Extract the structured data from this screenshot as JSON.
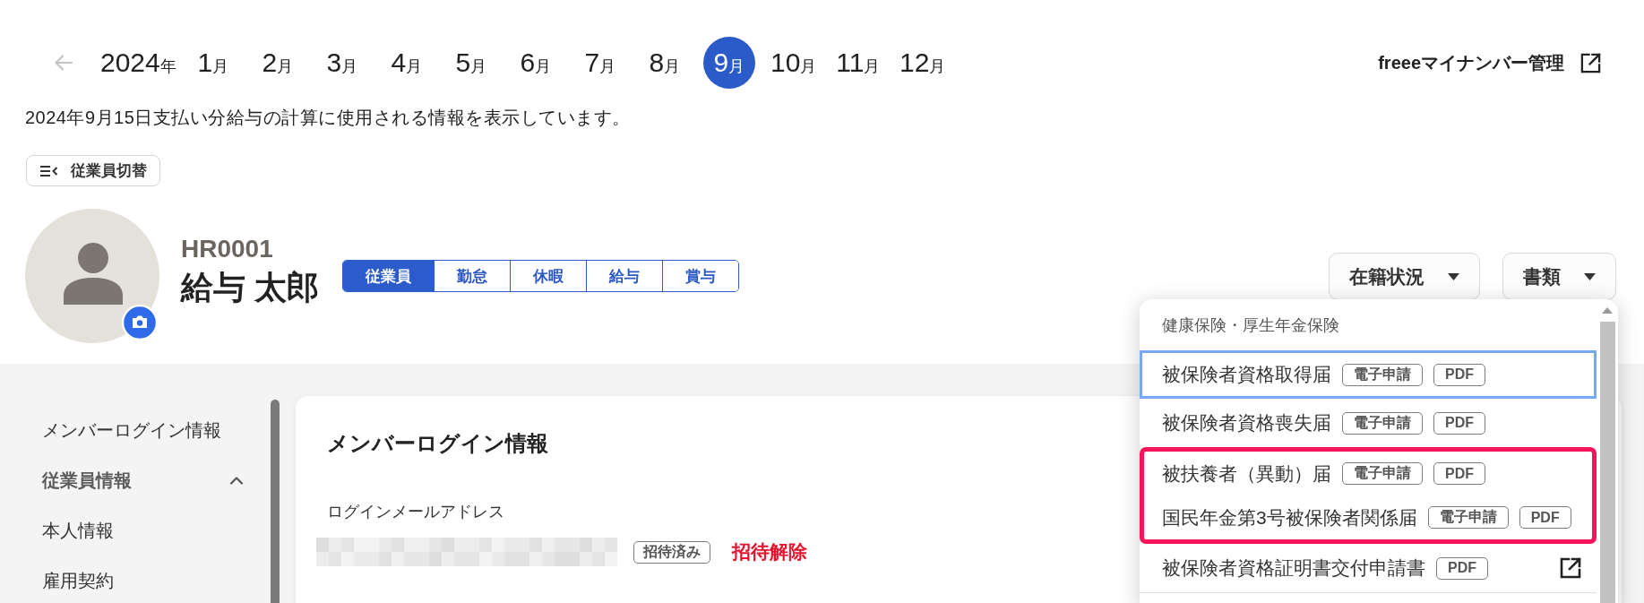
{
  "year_nav": {
    "previous_disabled": true,
    "year": "2024",
    "year_unit": "年",
    "months": [
      {
        "number": "1",
        "unit": "月",
        "selected": false
      },
      {
        "number": "2",
        "unit": "月",
        "selected": false
      },
      {
        "number": "3",
        "unit": "月",
        "selected": false
      },
      {
        "number": "4",
        "unit": "月",
        "selected": false
      },
      {
        "number": "5",
        "unit": "月",
        "selected": false
      },
      {
        "number": "6",
        "unit": "月",
        "selected": false
      },
      {
        "number": "7",
        "unit": "月",
        "selected": false
      },
      {
        "number": "8",
        "unit": "月",
        "selected": false
      },
      {
        "number": "9",
        "unit": "月",
        "selected": true
      },
      {
        "number": "10",
        "unit": "月",
        "selected": false
      },
      {
        "number": "11",
        "unit": "月",
        "selected": false
      },
      {
        "number": "12",
        "unit": "月",
        "selected": false
      }
    ]
  },
  "external_link": {
    "label": "freeeマイナンバー管理"
  },
  "notice": "2024年9月15日支払い分給与の計算に使用される情報を表示しています。",
  "switch_button": {
    "label": "従業員切替"
  },
  "employee": {
    "id": "HR0001",
    "name": "給与 太郎"
  },
  "tabs": [
    {
      "label": "従業員",
      "selected": true
    },
    {
      "label": "勤怠",
      "selected": false
    },
    {
      "label": "休暇",
      "selected": false
    },
    {
      "label": "給与",
      "selected": false
    },
    {
      "label": "賞与",
      "selected": false
    }
  ],
  "actions": [
    {
      "label": "在籍状況"
    },
    {
      "label": "書類"
    }
  ],
  "sidebar": {
    "items": [
      {
        "kind": "link",
        "label": "メンバーログイン情報"
      },
      {
        "kind": "group",
        "label": "従業員情報",
        "expanded": true,
        "children": [
          {
            "kind": "link",
            "label": "本人情報"
          },
          {
            "kind": "link",
            "label": "雇用契約"
          }
        ]
      }
    ]
  },
  "card": {
    "title": "メンバーログイン情報",
    "field_label": "ログインメールアドレス",
    "status": "招待済み",
    "action": "招待解除"
  },
  "documents_menu": {
    "section_title": "健康保険・厚生年金保険",
    "items": [
      {
        "name": "被保険者資格取得届",
        "focused": true,
        "highlighted": false,
        "external": false,
        "formats": [
          "電子申請",
          "PDF"
        ]
      },
      {
        "name": "被保険者資格喪失届",
        "focused": false,
        "highlighted": false,
        "external": false,
        "formats": [
          "電子申請",
          "PDF"
        ]
      },
      {
        "name": "被扶養者（異動）届",
        "focused": false,
        "highlighted": true,
        "external": false,
        "formats": [
          "電子申請",
          "PDF"
        ]
      },
      {
        "name": "国民年金第3号被保険者関係届",
        "focused": false,
        "highlighted": true,
        "external": false,
        "formats": [
          "電子申請",
          "PDF"
        ]
      },
      {
        "name": "被保険者資格証明書交付申請書",
        "focused": false,
        "highlighted": false,
        "external": true,
        "formats": [
          "PDF"
        ]
      }
    ]
  }
}
